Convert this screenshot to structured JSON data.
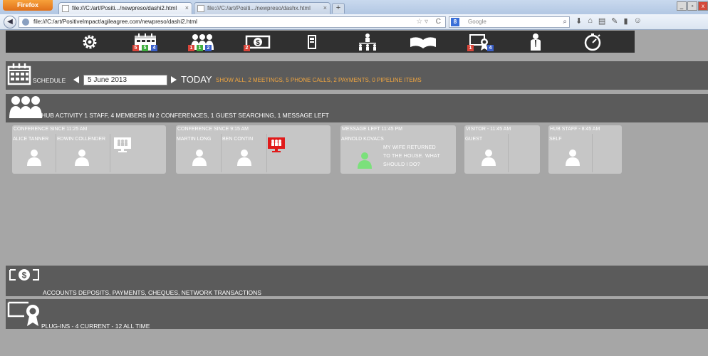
{
  "browser": {
    "app_button": "Firefox",
    "tabs": [
      {
        "title": "file:///C:/art/Positi.../newpreso/dashi2.html",
        "active": true
      },
      {
        "title": "file:///C:/art/Positi.../newpreso/dashx.html",
        "active": false
      }
    ],
    "new_tab": "+",
    "url": "file:///C:/art/PositiveImpact/agileagree.com/newpreso/dashi2.html",
    "search_placeholder": "Google",
    "search_engine": "8"
  },
  "toolbar": {
    "icons": [
      {
        "name": "settings-gear-icon"
      },
      {
        "name": "calendar-icon",
        "badges": [
          {
            "color": "red",
            "value": "5"
          },
          {
            "color": "green",
            "value": "5"
          },
          {
            "color": "blue",
            "value": "4"
          }
        ]
      },
      {
        "name": "people-icon",
        "badges": [
          {
            "color": "red",
            "value": "1"
          },
          {
            "color": "green",
            "value": "1"
          },
          {
            "color": "blue",
            "value": "2"
          }
        ]
      },
      {
        "name": "money-icon",
        "badges": [
          {
            "color": "red",
            "value": "2"
          }
        ]
      },
      {
        "name": "phone-book-icon"
      },
      {
        "name": "org-chart-icon"
      },
      {
        "name": "open-book-icon"
      },
      {
        "name": "certificate-icon",
        "badges": [
          {
            "color": "red",
            "value": "1"
          },
          {
            "color": "blue",
            "value": "4"
          }
        ]
      },
      {
        "name": "staff-person-icon"
      },
      {
        "name": "stopwatch-icon"
      }
    ]
  },
  "schedule": {
    "label": "SCHEDULE",
    "date": "5 June 2013",
    "today": "TODAY",
    "summary": "SHOW ALL, 2 MEETINGS, 5 PHONE CALLS, 2 PAYMENTS, 0 PIPELINE ITEMS"
  },
  "hub": {
    "summary": "HUB ACTIVITY 1 STAFF, 4 MEMBERS IN 2 CONFERENCES, 1 GUEST SEARCHING, 1 MESSAGE LEFT",
    "cards": [
      {
        "header": "CONFERENCE SINCE 11:25 AM",
        "people": [
          "ALICE TANNER",
          "EDWIN COLLENDER"
        ],
        "conference_status": "white"
      },
      {
        "header": "CONFERENCE SINCE 9:15 AM",
        "people": [
          "MARTIN LONG",
          "BEN CONTIN"
        ],
        "conference_status": "red"
      },
      {
        "header": "MESSAGE LEFT 11:45 PM",
        "people": [
          "ARNOLD KOVACS"
        ],
        "message": "MY WIFE RETURNED TO THE HOUSE. WHAT SHOULD I DO?"
      },
      {
        "header": "VISITOR - 11:45 AM",
        "people": [
          "GUEST"
        ]
      },
      {
        "header": "HUB STAFF - 8:45 AM",
        "people": [
          "SELF"
        ]
      }
    ]
  },
  "accounts": {
    "summary": "ACCOUNTS DEPOSITS, PAYMENTS, CHEQUES, NETWORK TRANSACTIONS"
  },
  "plugins": {
    "summary": "PLUG-INS - 4 CURRENT - 12 ALL TIME"
  },
  "colors": {
    "section_bar": "#5b5b5b",
    "toolbar": "#303030",
    "page": "#a6a6a6",
    "highlight_orange": "#f0a640",
    "card": "#c6c6c6",
    "alert_red": "#e01a1a",
    "message_green": "#7be07b"
  }
}
